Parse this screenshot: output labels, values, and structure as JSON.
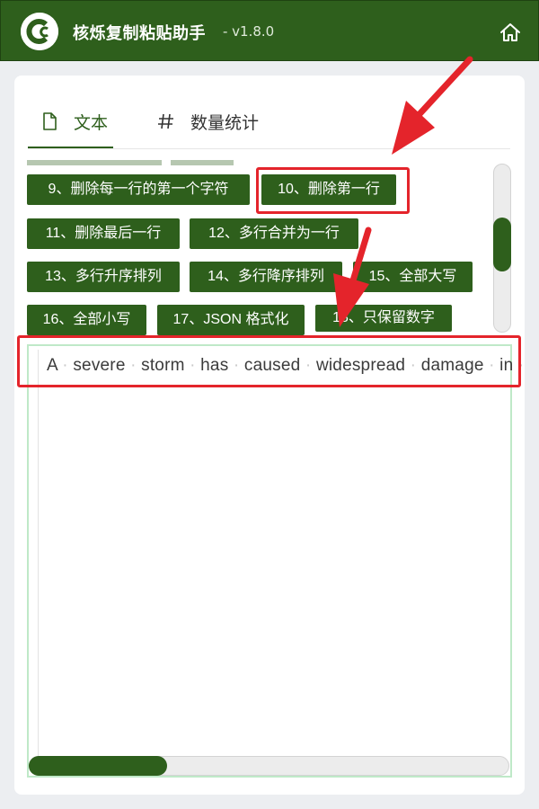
{
  "app": {
    "title": "核烁复制粘贴助手",
    "version": "- v1.8.0",
    "logo_icon": "copy-logo-icon",
    "home_icon": "home-icon"
  },
  "tabs": [
    {
      "label": "文本",
      "icon": "document-icon",
      "active": true
    },
    {
      "label": "数量统计",
      "icon": "hash-icon",
      "active": false
    }
  ],
  "buttons": [
    "9、删除每一行的第一个字符",
    "10、删除第一行",
    "11、删除最后一行",
    "12、多行合并为一行",
    "13、多行升序排列",
    "14、多行降序排列",
    "15、全部大写",
    "16、全部小写",
    "17、JSON 格式化",
    "18、只保留数字"
  ],
  "editor": {
    "content": "A·severe·storm·has·caused·widespread·damage·in·"
  },
  "colors": {
    "accent": "#2e5f1c",
    "annotation": "#e4242b",
    "editor_border": "#bfe9c8"
  }
}
